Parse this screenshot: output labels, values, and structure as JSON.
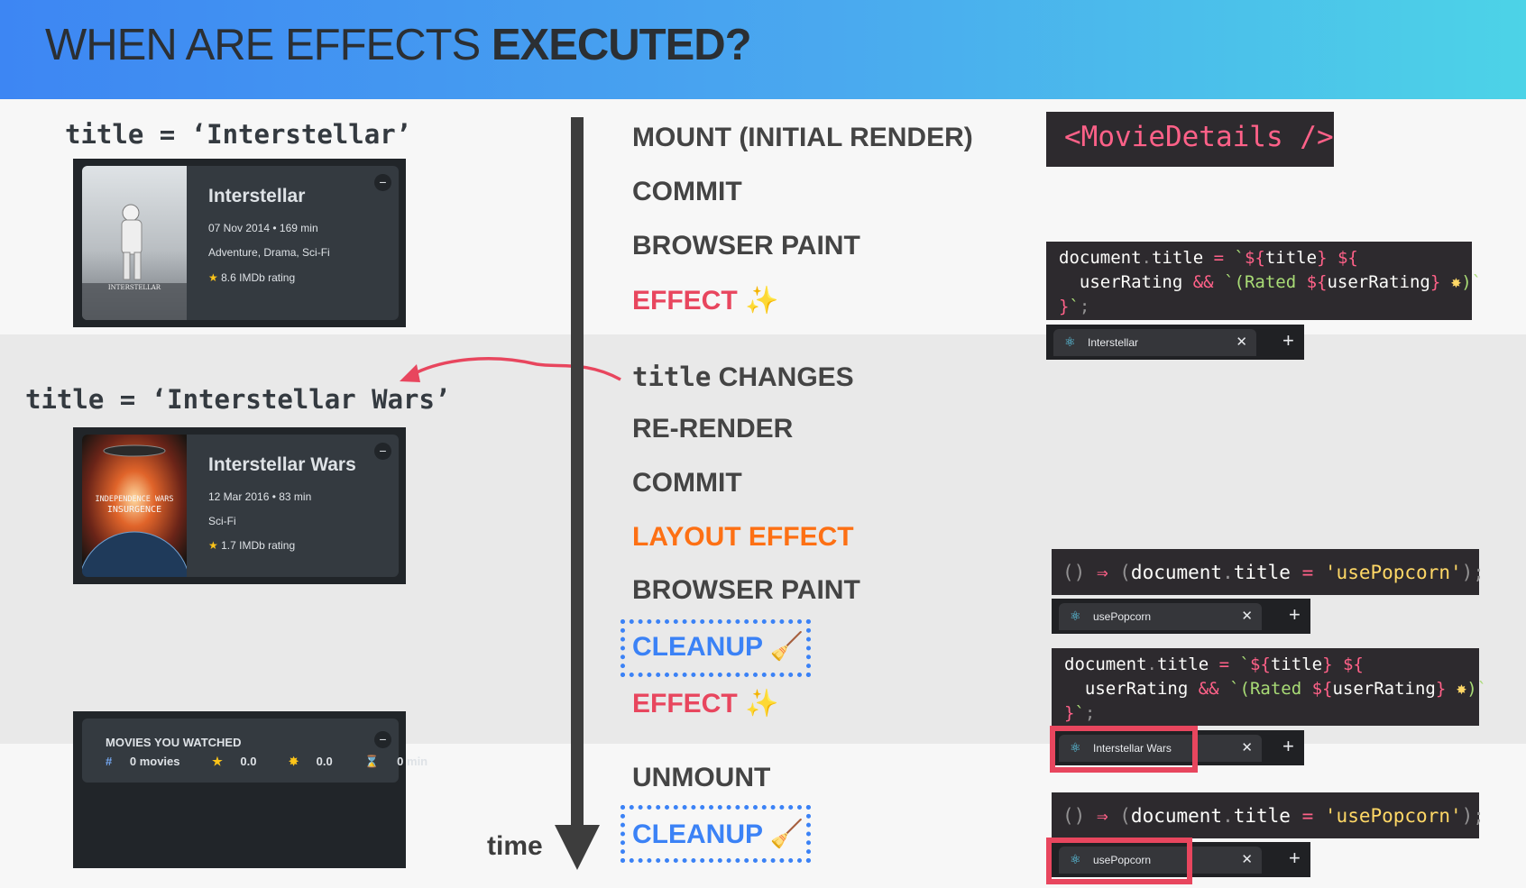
{
  "header": {
    "title_main": "WHEN ARE EFFECTS",
    "title_bold": "EXECUTED?"
  },
  "left": {
    "assign1": "title = ‘Interstellar’",
    "assign2": "title = ‘Interstellar Wars’",
    "movie1": {
      "title": "Interstellar",
      "released_runtime": "07 Nov 2014 • 169 min",
      "genre": "Adventure, Drama, Sci-Fi",
      "rating": "8.6 IMDb rating",
      "poster_text": "INTERSTELLAR"
    },
    "movie2": {
      "title": "Interstellar Wars",
      "released_runtime": "12 Mar 2016 • 83 min",
      "genre": "Sci-Fi",
      "rating": "1.7 IMDb rating",
      "poster_text_1": "INDEPENDENCE WARS",
      "poster_text_2": "INSURGENCE"
    },
    "watched": {
      "title": "MOVIES YOU WATCHED",
      "movies": "0 movies",
      "imdb": "0.0",
      "user": "0.0",
      "runtime": "0 min"
    }
  },
  "timeline": {
    "axis_label": "time",
    "steps": [
      {
        "label": "MOUNT (INITIAL RENDER)"
      },
      {
        "label": "COMMIT"
      },
      {
        "label": "BROWSER PAINT"
      },
      {
        "label": "EFFECT",
        "icon": "sparkles-icon"
      },
      {
        "label_code": "title",
        "label": "CHANGES"
      },
      {
        "label": "RE-RENDER"
      },
      {
        "label": "COMMIT"
      },
      {
        "label": "LAYOUT EFFECT"
      },
      {
        "label": "BROWSER PAINT"
      },
      {
        "label": "CLEANUP",
        "icon": "broom-icon"
      },
      {
        "label": "EFFECT",
        "icon": "sparkles-icon"
      },
      {
        "label": "UNMOUNT"
      },
      {
        "label": "CLEANUP",
        "icon": "broom-icon"
      }
    ]
  },
  "right": {
    "component_tag": "<MovieDetails />",
    "tabs": {
      "tab1": "Interstellar",
      "tab2": "usePopcorn",
      "tab3": "Interstellar Wars",
      "tab4": "usePopcorn"
    }
  },
  "colors": {
    "effect": "#e8465e",
    "layout_effect": "#fd7014",
    "cleanup": "#3b82f6",
    "highlight": "#e8465e"
  }
}
